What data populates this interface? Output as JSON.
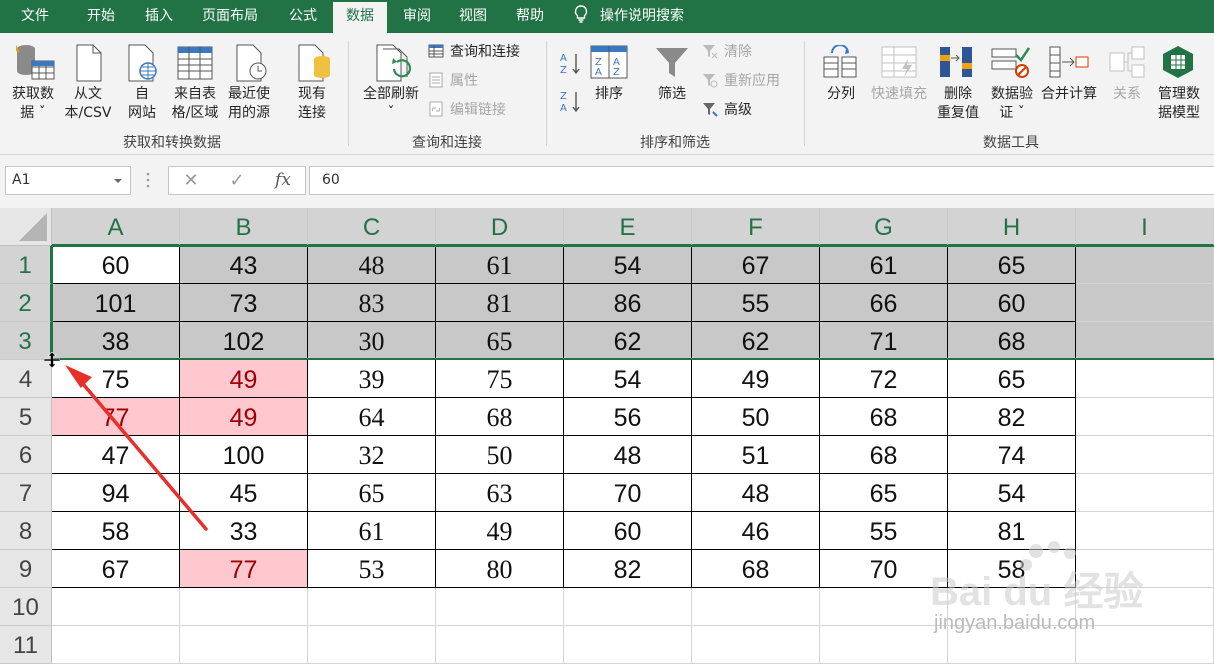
{
  "menu": {
    "tabs": [
      "文件",
      "开始",
      "插入",
      "页面布局",
      "公式",
      "数据",
      "审阅",
      "视图",
      "帮助"
    ],
    "active_tab": "数据",
    "tell_me": "操作说明搜索"
  },
  "ribbon": {
    "get_transform": {
      "label": "获取和转换数据",
      "get_data": [
        "获取数",
        "据 ˇ"
      ],
      "from_text": [
        "从文",
        "本/CSV"
      ],
      "from_web": [
        "自",
        "网站"
      ],
      "from_table": [
        "来自表",
        "格/区域"
      ],
      "recent_sources": [
        "最近使",
        "用的源"
      ],
      "existing_conn": [
        "现有",
        "连接"
      ]
    },
    "queries": {
      "label": "查询和连接",
      "refresh_all": [
        "全部刷新",
        "ˇ"
      ],
      "queries_conn": "查询和连接",
      "properties": "属性",
      "edit_links": "编辑链接"
    },
    "sort_filter": {
      "label": "排序和筛选",
      "sort": "排序",
      "filter": "筛选",
      "clear": "清除",
      "reapply": "重新应用",
      "advanced": "高级"
    },
    "data_tools": {
      "label": "数据工具",
      "text_to_columns": "分列",
      "flash_fill": "快速填充",
      "remove_dup": [
        "删除",
        "重复值"
      ],
      "validation": [
        "数据验",
        "证 ˇ"
      ],
      "consolidate": "合并计算",
      "relationships": "关系",
      "data_model": [
        "管理数",
        "据模型"
      ]
    }
  },
  "formula_bar": {
    "name_box": "A1",
    "value": "60",
    "fx": "fx"
  },
  "sheet": {
    "columns": [
      "A",
      "B",
      "C",
      "D",
      "E",
      "F",
      "G",
      "H",
      "I"
    ],
    "rows": [
      "1",
      "2",
      "3",
      "4",
      "5",
      "6",
      "7",
      "8",
      "9",
      "10",
      "11"
    ],
    "data": [
      [
        "60",
        "43",
        "48",
        "61",
        "54",
        "67",
        "61",
        "65"
      ],
      [
        "101",
        "73",
        "83",
        "81",
        "86",
        "55",
        "66",
        "60"
      ],
      [
        "38",
        "102",
        "30",
        "65",
        "62",
        "62",
        "71",
        "68"
      ],
      [
        "75",
        "49",
        "39",
        "75",
        "54",
        "49",
        "72",
        "65"
      ],
      [
        "77",
        "49",
        "64",
        "68",
        "56",
        "50",
        "68",
        "82"
      ],
      [
        "47",
        "100",
        "32",
        "50",
        "48",
        "51",
        "68",
        "74"
      ],
      [
        "94",
        "45",
        "65",
        "63",
        "70",
        "48",
        "65",
        "54"
      ],
      [
        "58",
        "33",
        "61",
        "49",
        "60",
        "46",
        "55",
        "81"
      ],
      [
        "67",
        "77",
        "53",
        "80",
        "82",
        "68",
        "70",
        "58"
      ]
    ],
    "pink_cells": [
      "B4",
      "A5",
      "B5",
      "B9"
    ],
    "highlight_color": "#ffc7ce",
    "selection_color": "#c8c8c8"
  },
  "colors": {
    "accent": "#217346",
    "annotation_arrow": "#e8302a"
  },
  "watermark": {
    "brand": "Bai du 经验",
    "url": "jingyan.baidu.com"
  }
}
